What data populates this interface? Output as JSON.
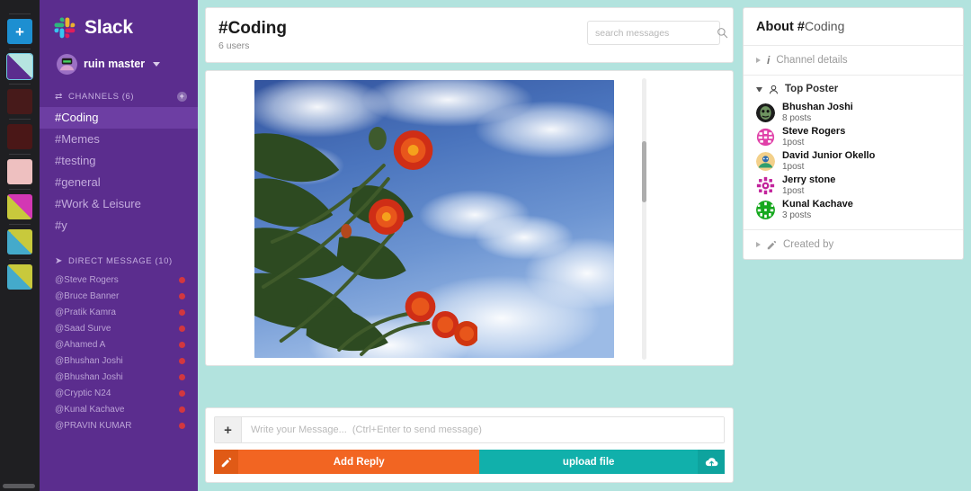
{
  "colors": {
    "page_bg": "#b2e3de",
    "rail_bg": "#1f1f22",
    "sidebar_bg": "#5b2d8e",
    "sidebar_active": "#6d3ea3",
    "accent_orange": "#f26522",
    "accent_teal": "#11b0ab",
    "unread_dot": "#d2373f",
    "add_button_blue": "#1d8fd1"
  },
  "rail": {
    "add_button_label": "+",
    "add_button_icon": "plus-icon",
    "tiles": [
      {
        "name": "workspace-thumb-1",
        "a": "#5b2d8e",
        "b": "#b6e4e0"
      },
      {
        "name": "workspace-thumb-2",
        "a": "#471a1a",
        "b": "#471a1a"
      },
      {
        "name": "workspace-thumb-3",
        "a": "#4a1717",
        "b": "#4a1717"
      },
      {
        "name": "workspace-thumb-4",
        "a": "#eec0c0",
        "b": "#eec0c0"
      },
      {
        "name": "workspace-thumb-5",
        "a": "#c8c93c",
        "b": "#d337b4"
      },
      {
        "name": "workspace-thumb-6",
        "a": "#44aacb",
        "b": "#c8c93c"
      },
      {
        "name": "workspace-thumb-7",
        "a": "#44aacb",
        "b": "#c8c93c"
      }
    ]
  },
  "sidebar": {
    "brand": "Slack",
    "brand_icon": "slack-logo-icon",
    "user": {
      "name": "ruin master",
      "avatar_icon": "user-avatar",
      "caret_icon": "chevron-down-icon"
    },
    "channels_section": {
      "icon": "swap-icon",
      "label": "CHANNELS (6)",
      "add_icon": "plus-circle-icon"
    },
    "channels": [
      {
        "label": "#Coding",
        "active": true
      },
      {
        "label": "#Memes",
        "active": false
      },
      {
        "label": "#testing",
        "active": false
      },
      {
        "label": "#general",
        "active": false
      },
      {
        "label": "#Work & Leisure",
        "active": false
      },
      {
        "label": "#y",
        "active": false
      }
    ],
    "dm_section": {
      "icon": "paper-plane-icon",
      "label": "DIRECT MESSAGE (10)"
    },
    "direct_messages": [
      {
        "label": "@Steve Rogers",
        "unread": true
      },
      {
        "label": "@Bruce Banner",
        "unread": true
      },
      {
        "label": "@Pratik Kamra",
        "unread": true
      },
      {
        "label": "@Saad Surve",
        "unread": true
      },
      {
        "label": "@Ahamed A",
        "unread": true
      },
      {
        "label": "@Bhushan Joshi",
        "unread": true
      },
      {
        "label": "@Bhushan Joshi",
        "unread": true
      },
      {
        "label": "@Cryptic N24",
        "unread": true
      },
      {
        "label": "@Kunal Kachave",
        "unread": true
      },
      {
        "label": "@PRAVIN KUMAR",
        "unread": true
      }
    ]
  },
  "header": {
    "channel_title": "#Coding",
    "members": "6 users",
    "search_placeholder": "search messages",
    "search_value": "",
    "search_icon": "search-icon"
  },
  "messages": {
    "attachment_alt": "photo of red flowers against blue sky with clouds",
    "scrollbar_name": "message-scrollbar"
  },
  "composer": {
    "add_icon": "plus-icon",
    "input_placeholder": "Write your Message...  (Ctrl+Enter to send message)",
    "input_value": "",
    "reply_button_label": "Add Reply",
    "reply_button_icon": "compose-icon",
    "upload_button_label": "upload file",
    "upload_button_icon": "cloud-upload-icon"
  },
  "about": {
    "title_prefix": "About ",
    "title_hash": "#",
    "title_channel": "Coding",
    "channel_details": {
      "label": "Channel details",
      "icon": "info-icon",
      "toggle_icon": "triangle-right-icon"
    },
    "top_poster": {
      "label": "Top Poster",
      "icon": "person-icon",
      "toggle_icon": "triangle-down-icon"
    },
    "posters": [
      {
        "name": "Bhushan Joshi",
        "posts": "8 posts",
        "avatar": "#2e2e2e",
        "avatar2": "#7aa47a"
      },
      {
        "name": "Steve Rogers",
        "posts": "1post",
        "avatar": "#e040a8",
        "avatar2": "#ffffff"
      },
      {
        "name": "David Junior Okello",
        "posts": "1post",
        "avatar": "#f0c040",
        "avatar2": "#2b6cb0"
      },
      {
        "name": "Jerry stone",
        "posts": "1post",
        "avatar": "#c2239b",
        "avatar2": "#ffffff"
      },
      {
        "name": "Kunal Kachave",
        "posts": "3 posts",
        "avatar": "#16a81e",
        "avatar2": "#ffffff"
      }
    ],
    "created_by": {
      "label": "Created by",
      "icon": "pencil-icon",
      "toggle_icon": "triangle-right-icon"
    }
  }
}
